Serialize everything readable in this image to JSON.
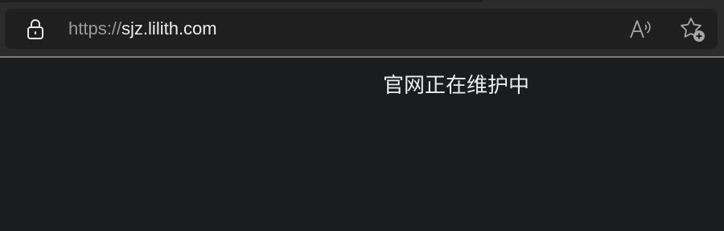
{
  "address_bar": {
    "url_scheme": "https://",
    "url_host": "sjz.lilith.com"
  },
  "icons": {
    "security": "lock-icon",
    "read_aloud": "read-aloud-icon",
    "favorites": "add-favorite-icon"
  },
  "page": {
    "message": "官网正在维护中"
  },
  "colors": {
    "page_background": "#1b1c1e",
    "toolbar_background": "#2b2b2b",
    "address_bar_background": "#1f1f1f",
    "text": "#ececec"
  }
}
